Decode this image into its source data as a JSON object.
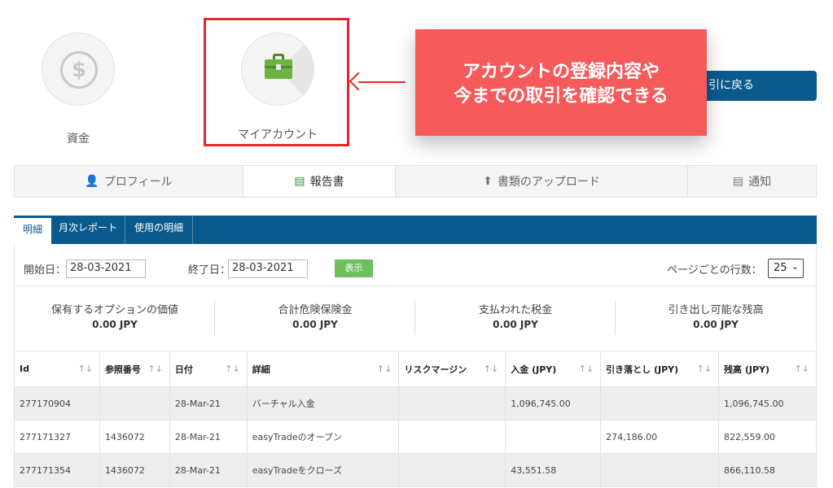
{
  "top_tiles": {
    "funds_label": "資金",
    "account_label": "マイアカウント"
  },
  "callout": {
    "line1": "アカウントの登録内容や",
    "line2": "今までの取引を確認できる"
  },
  "back_button_label": "引に戻る",
  "profile_tabs": [
    {
      "icon": "user-icon",
      "label": "プロフィール"
    },
    {
      "icon": "report-icon",
      "label": "報告書",
      "active": true
    },
    {
      "icon": "upload-icon",
      "label": "書類のアップロード"
    },
    {
      "icon": "notice-icon",
      "label": "通知"
    }
  ],
  "sub_tabs": [
    {
      "label": "明細",
      "active": true
    },
    {
      "label": "月次レポート"
    },
    {
      "label": "使用の明細"
    }
  ],
  "filter": {
    "start_label": "開始日：",
    "start_value": "28-03-2021",
    "end_label": "終了日：",
    "end_value": "28-03-2021",
    "show_button": "表示",
    "rows_label": "ページごとの行数：",
    "rows_value": "25"
  },
  "summary": [
    {
      "label": "保有するオプションの価値",
      "value": "0.00 JPY"
    },
    {
      "label": "合計危険保険金",
      "value": "0.00 JPY"
    },
    {
      "label": "支払われた税金",
      "value": "0.00 JPY"
    },
    {
      "label": "引き出し可能な残高",
      "value": "0.00 JPY"
    }
  ],
  "table": {
    "headers": [
      "Id",
      "参照番号",
      "日付",
      "詳細",
      "リスクマージン",
      "入金 (JPY)",
      "引き落とし (JPY)",
      "残高 (JPY)"
    ],
    "sort_glyphs": [
      "↑↓",
      "↑↓",
      "↑↓",
      "↑↓",
      "↑↓",
      "↑↓",
      "↑↓",
      "↑↓"
    ],
    "rows": [
      [
        "277170904",
        "",
        "28-Mar-21",
        "バーチャル入金",
        "",
        "1,096,745.00",
        "",
        "1,096,745.00"
      ],
      [
        "277171327",
        "1436072",
        "28-Mar-21",
        "easyTradeのオープン",
        "",
        "",
        "274,186.00",
        "822,559.00"
      ],
      [
        "277171354",
        "1436072",
        "28-Mar-21",
        "easyTradeをクローズ",
        "",
        "43,551.58",
        "",
        "866,110.58"
      ]
    ]
  },
  "colors": {
    "primary": "#0b5a8e",
    "callout": "#f75a5a",
    "highlight": "#e62727",
    "show_button": "#6fbf5f"
  }
}
